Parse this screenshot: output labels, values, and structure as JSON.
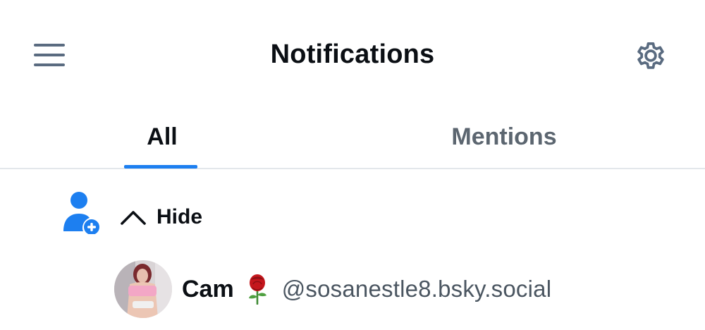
{
  "header": {
    "title": "Notifications",
    "menu_icon": "hamburger-menu-icon",
    "settings_icon": "gear-icon"
  },
  "tabs": [
    {
      "label": "All",
      "active": true
    },
    {
      "label": "Mentions",
      "active": false
    }
  ],
  "group": {
    "icon": "person-add-icon",
    "toggle_label": "Hide",
    "toggle_icon": "chevron-up-icon"
  },
  "user": {
    "display_name": "Cam",
    "emoji_icon": "rose-icon",
    "handle": "@sosanestle8.bsky.social"
  },
  "colors": {
    "accent": "#1d7ff0",
    "text_primary": "#0b0f14",
    "text_secondary": "#5c6670",
    "icon_muted": "#5a6b80",
    "divider": "#e3e7eb"
  }
}
